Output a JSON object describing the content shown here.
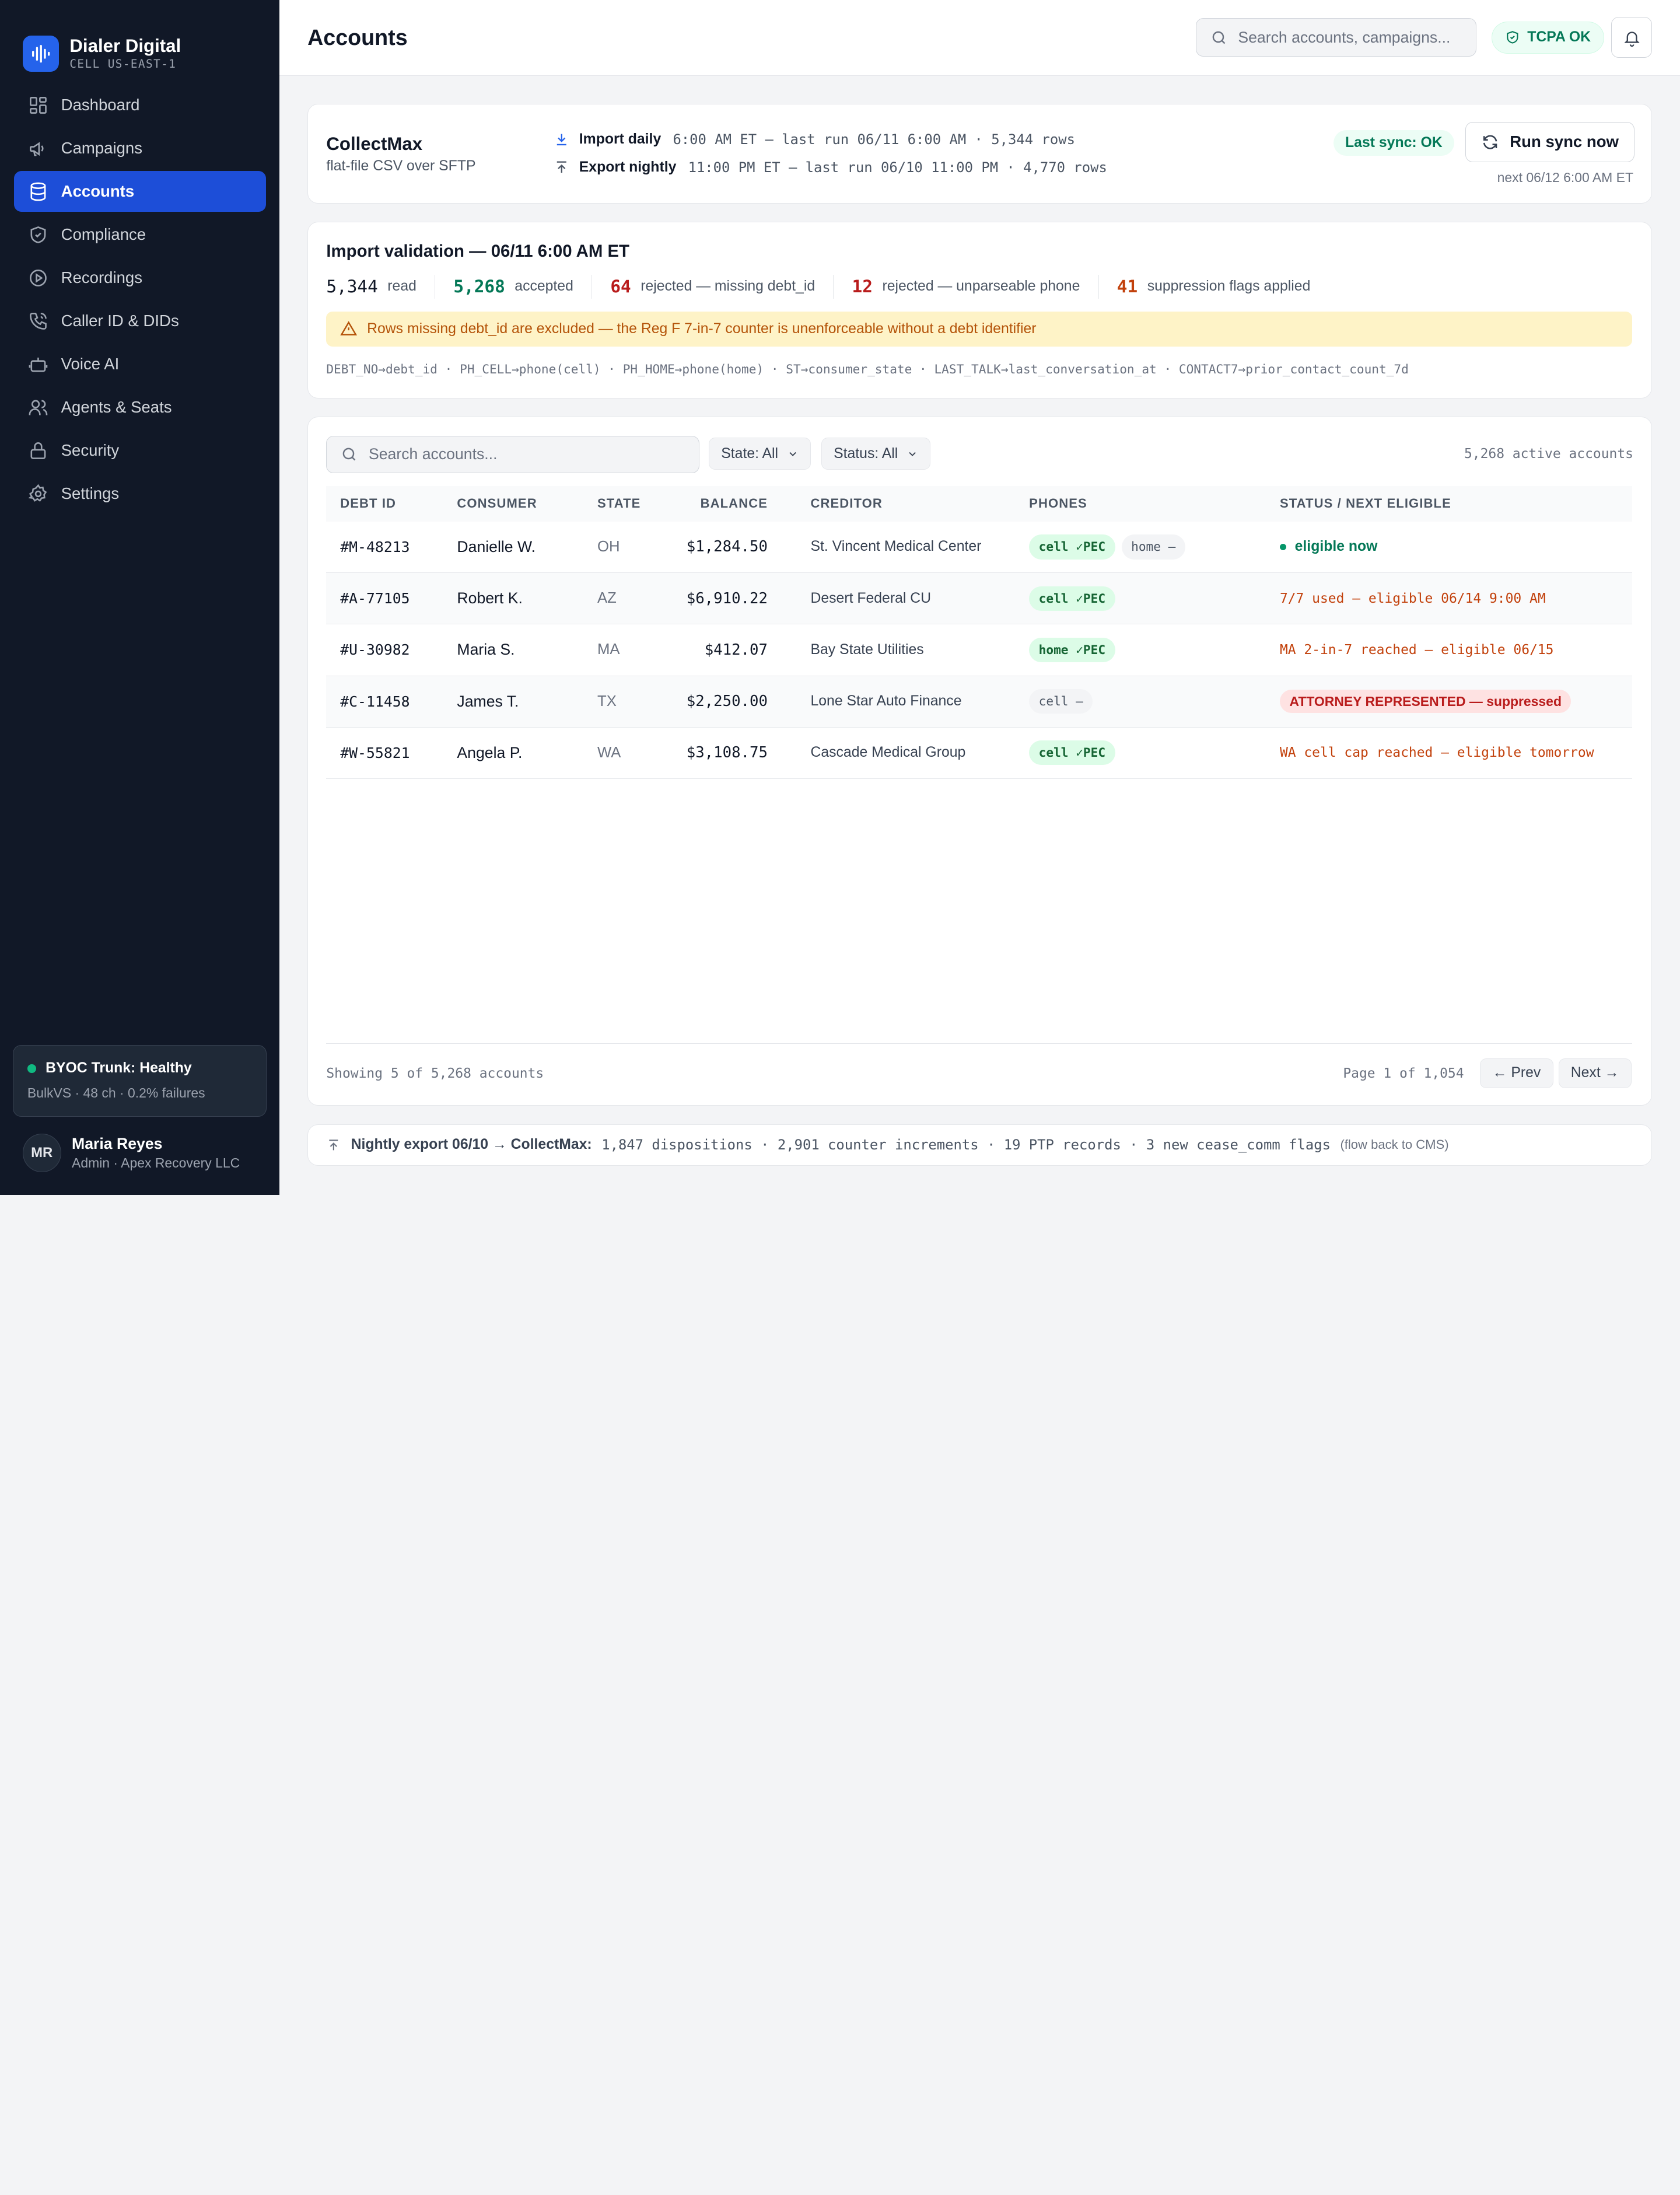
{
  "brand": {
    "title": "Dialer Digital",
    "subtitle": "CELL US-EAST-1"
  },
  "sidebar": {
    "items": [
      {
        "label": "Dashboard",
        "icon": "grid-icon"
      },
      {
        "label": "Campaigns",
        "icon": "megaphone-icon"
      },
      {
        "label": "Accounts",
        "icon": "database-icon",
        "active": true
      },
      {
        "label": "Compliance",
        "icon": "shield-icon"
      },
      {
        "label": "Recordings",
        "icon": "play-circle-icon"
      },
      {
        "label": "Caller ID & DIDs",
        "icon": "phone-icon"
      },
      {
        "label": "Voice AI",
        "icon": "robot-icon"
      },
      {
        "label": "Agents & Seats",
        "icon": "users-icon"
      },
      {
        "label": "Security",
        "icon": "lock-icon"
      },
      {
        "label": "Settings",
        "icon": "gear-icon"
      }
    ],
    "trunk": {
      "title": "BYOC Trunk: Healthy",
      "sub": "BulkVS · 48 ch · 0.2% failures"
    },
    "user": {
      "initials": "MR",
      "name": "Maria Reyes",
      "role": "Admin · Apex Recovery LLC"
    }
  },
  "header": {
    "title": "Accounts",
    "search_placeholder": "Search accounts, campaigns...",
    "tcpa": "TCPA OK"
  },
  "cms": {
    "name": "CollectMax",
    "sub": "flat-file CSV over SFTP",
    "import_label": "Import daily",
    "import_detail": "6:00 AM ET — last run 06/11 6:00 AM · 5,344 rows",
    "export_label": "Export nightly",
    "export_detail": "11:00 PM ET — last run 06/10 11:00 PM · 4,770 rows",
    "last_sync": "Last sync: OK",
    "run_button": "Run sync now",
    "next_run": "next 06/12 6:00 AM ET"
  },
  "validation": {
    "title": "Import validation — 06/11 6:00 AM ET",
    "stats": [
      {
        "num": "5,344",
        "label": "read",
        "color": "#111827"
      },
      {
        "num": "5,268",
        "label": "accepted",
        "color": "#047857"
      },
      {
        "num": "64",
        "label": "rejected — missing debt_id",
        "color": "#b91c1c"
      },
      {
        "num": "12",
        "label": "rejected — unparseable phone",
        "color": "#b91c1c"
      },
      {
        "num": "41",
        "label": "suppression flags applied",
        "color": "#c2410c"
      }
    ],
    "warning": "Rows missing debt_id are excluded — the Reg F 7-in-7 counter is unenforceable without a debt identifier",
    "mapping": "DEBT_NO→debt_id · PH_CELL→phone(cell) · PH_HOME→phone(home) · ST→consumer_state · LAST_TALK→last_conversation_at · CONTACT7→prior_contact_count_7d"
  },
  "accounts": {
    "search_placeholder": "Search accounts...",
    "state_filter": "State: All",
    "status_filter": "Status: All",
    "active_count": "5,268 active accounts",
    "columns": [
      "DEBT ID",
      "CONSUMER",
      "STATE",
      "BALANCE",
      "CREDITOR",
      "PHONES",
      "STATUS / NEXT ELIGIBLE"
    ],
    "rows": [
      {
        "debt_id": "#M-48213",
        "consumer": "Danielle W.",
        "state": "OH",
        "balance": "$1,284.50",
        "creditor": "St. Vincent Medical Center",
        "phones": [
          {
            "label": "cell ✓PEC",
            "kind": "ok"
          },
          {
            "label": "home —",
            "kind": "none"
          }
        ],
        "status": "eligible now",
        "status_kind": "eligible"
      },
      {
        "debt_id": "#A-77105",
        "consumer": "Robert K.",
        "state": "AZ",
        "balance": "$6,910.22",
        "creditor": "Desert Federal CU",
        "phones": [
          {
            "label": "cell ✓PEC",
            "kind": "ok"
          }
        ],
        "status": "7/7 used — eligible 06/14 9:00 AM",
        "status_kind": "warn"
      },
      {
        "debt_id": "#U-30982",
        "consumer": "Maria S.",
        "state": "MA",
        "balance": "$412.07",
        "creditor": "Bay State Utilities",
        "phones": [
          {
            "label": "home ✓PEC",
            "kind": "ok"
          }
        ],
        "status": "MA 2-in-7 reached — eligible 06/15",
        "status_kind": "warn"
      },
      {
        "debt_id": "#C-11458",
        "consumer": "James T.",
        "state": "TX",
        "balance": "$2,250.00",
        "creditor": "Lone Star Auto Finance",
        "phones": [
          {
            "label": "cell —",
            "kind": "none"
          }
        ],
        "status": "ATTORNEY REPRESENTED — suppressed",
        "status_kind": "suppressed"
      },
      {
        "debt_id": "#W-55821",
        "consumer": "Angela P.",
        "state": "WA",
        "balance": "$3,108.75",
        "creditor": "Cascade Medical Group",
        "phones": [
          {
            "label": "cell ✓PEC",
            "kind": "ok"
          }
        ],
        "status": "WA cell cap reached — eligible tomorrow",
        "status_kind": "warn"
      }
    ],
    "showing": "Showing 5 of 5,268 accounts",
    "page_info": "Page 1 of 1,054",
    "prev": "← Prev",
    "next": "Next →"
  },
  "export_bar": {
    "label": "Nightly export 06/10 → CollectMax:",
    "detail": "1,847 dispositions · 2,901 counter increments · 19 PTP records · 3 new cease_comm flags",
    "note": "(flow back to CMS)"
  }
}
